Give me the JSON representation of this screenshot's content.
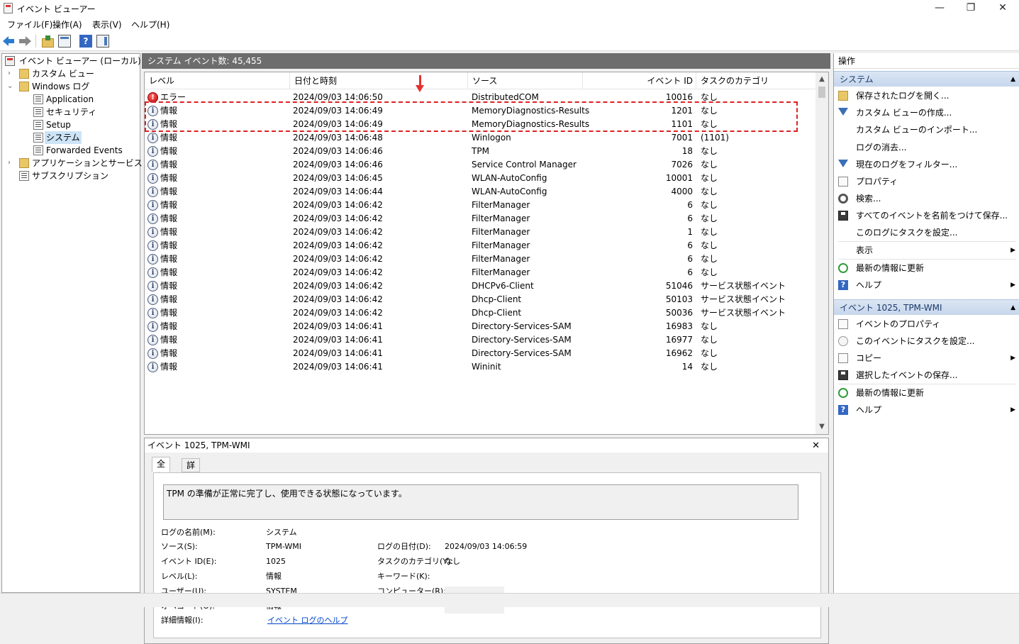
{
  "window": {
    "title": "イベント ビューアー",
    "minimize": "—",
    "maximize": "❐",
    "close": "✕"
  },
  "menu": [
    "ファイル(F)",
    "操作(A)",
    "表示(V)",
    "ヘルプ(H)"
  ],
  "toolbar": {
    "help_glyph": "?"
  },
  "tree": {
    "root": "イベント ビューアー (ローカル)",
    "custom_view": "カスタム ビュー",
    "windows_logs": "Windows ログ",
    "application": "Application",
    "security": "セキュリティ",
    "setup": "Setup",
    "system": "システム",
    "forwarded": "Forwarded Events",
    "apps_services": "アプリケーションとサービス ログ",
    "subscriptions": "サブスクリプション",
    "expand_glyph": "›",
    "collapse_glyph": "⌄"
  },
  "center": {
    "header": "システム    イベント数: 45,455",
    "columns": [
      "レベル",
      "日付と時刻",
      "ソース",
      "イベント ID",
      "タスクのカテゴリ"
    ],
    "rows": [
      {
        "level": "エラー",
        "type": "error",
        "datetime": "2024/09/03 14:06:50",
        "source": "DistributedCOM",
        "id": "10016",
        "category": "なし"
      },
      {
        "level": "情報",
        "type": "info",
        "datetime": "2024/09/03 14:06:49",
        "source": "MemoryDiagnostics-Results",
        "id": "1201",
        "category": "なし"
      },
      {
        "level": "情報",
        "type": "info",
        "datetime": "2024/09/03 14:06:49",
        "source": "MemoryDiagnostics-Results",
        "id": "1101",
        "category": "なし"
      },
      {
        "level": "情報",
        "type": "info",
        "datetime": "2024/09/03 14:06:48",
        "source": "Winlogon",
        "id": "7001",
        "category": "(1101)"
      },
      {
        "level": "情報",
        "type": "info",
        "datetime": "2024/09/03 14:06:46",
        "source": "TPM",
        "id": "18",
        "category": "なし"
      },
      {
        "level": "情報",
        "type": "info",
        "datetime": "2024/09/03 14:06:46",
        "source": "Service Control Manager",
        "id": "7026",
        "category": "なし"
      },
      {
        "level": "情報",
        "type": "info",
        "datetime": "2024/09/03 14:06:45",
        "source": "WLAN-AutoConfig",
        "id": "10001",
        "category": "なし"
      },
      {
        "level": "情報",
        "type": "info",
        "datetime": "2024/09/03 14:06:44",
        "source": "WLAN-AutoConfig",
        "id": "4000",
        "category": "なし"
      },
      {
        "level": "情報",
        "type": "info",
        "datetime": "2024/09/03 14:06:42",
        "source": "FilterManager",
        "id": "6",
        "category": "なし"
      },
      {
        "level": "情報",
        "type": "info",
        "datetime": "2024/09/03 14:06:42",
        "source": "FilterManager",
        "id": "6",
        "category": "なし"
      },
      {
        "level": "情報",
        "type": "info",
        "datetime": "2024/09/03 14:06:42",
        "source": "FilterManager",
        "id": "1",
        "category": "なし"
      },
      {
        "level": "情報",
        "type": "info",
        "datetime": "2024/09/03 14:06:42",
        "source": "FilterManager",
        "id": "6",
        "category": "なし"
      },
      {
        "level": "情報",
        "type": "info",
        "datetime": "2024/09/03 14:06:42",
        "source": "FilterManager",
        "id": "6",
        "category": "なし"
      },
      {
        "level": "情報",
        "type": "info",
        "datetime": "2024/09/03 14:06:42",
        "source": "FilterManager",
        "id": "6",
        "category": "なし"
      },
      {
        "level": "情報",
        "type": "info",
        "datetime": "2024/09/03 14:06:42",
        "source": "DHCPv6-Client",
        "id": "51046",
        "category": "サービス状態イベント"
      },
      {
        "level": "情報",
        "type": "info",
        "datetime": "2024/09/03 14:06:42",
        "source": "Dhcp-Client",
        "id": "50103",
        "category": "サービス状態イベント"
      },
      {
        "level": "情報",
        "type": "info",
        "datetime": "2024/09/03 14:06:42",
        "source": "Dhcp-Client",
        "id": "50036",
        "category": "サービス状態イベント"
      },
      {
        "level": "情報",
        "type": "info",
        "datetime": "2024/09/03 14:06:41",
        "source": "Directory-Services-SAM",
        "id": "16983",
        "category": "なし"
      },
      {
        "level": "情報",
        "type": "info",
        "datetime": "2024/09/03 14:06:41",
        "source": "Directory-Services-SAM",
        "id": "16977",
        "category": "なし"
      },
      {
        "level": "情報",
        "type": "info",
        "datetime": "2024/09/03 14:06:41",
        "source": "Directory-Services-SAM",
        "id": "16962",
        "category": "なし"
      },
      {
        "level": "情報",
        "type": "info",
        "datetime": "2024/09/03 14:06:41",
        "source": "Wininit",
        "id": "14",
        "category": "なし"
      }
    ],
    "scroll": {
      "up": "▲",
      "down": "▼"
    }
  },
  "detail": {
    "header": "イベント 1025, TPM-WMI",
    "close": "✕",
    "tabs": [
      "全般",
      "詳細"
    ],
    "message": "TPM の準備が正常に完了し、使用できる状態になっています。",
    "log_name_label": "ログの名前(M):",
    "log_name": "システム",
    "source_label": "ソース(S):",
    "source": "TPM-WMI",
    "logged_label": "ログの日付(D):",
    "logged": "2024/09/03 14:06:59",
    "event_id_label": "イベント ID(E):",
    "event_id": "1025",
    "task_label": "タスクのカテゴリ(Y):",
    "task": "なし",
    "level_label": "レベル(L):",
    "level": "情報",
    "keywords_label": "キーワード(K):",
    "user_label": "ユーザー(U):",
    "user": "SYSTEM",
    "computer_label": "コンピューター(R):",
    "opcode_label": "オペコード(O):",
    "opcode": "情報",
    "more_label": "詳細情報(I):",
    "more_link": "イベント ログのヘルプ"
  },
  "actions": {
    "title": "操作",
    "section1": "システム",
    "section1_items": [
      "保存されたログを開く...",
      "カスタム ビューの作成...",
      "カスタム ビューのインポート...",
      "ログの消去...",
      "現在のログをフィルター...",
      "プロパティ",
      "検索...",
      "すべてのイベントを名前をつけて保存...",
      "このログにタスクを設定...",
      "表示",
      "最新の情報に更新",
      "ヘルプ"
    ],
    "section2": "イベント 1025, TPM-WMI",
    "section2_items": [
      "イベントのプロパティ",
      "このイベントにタスクを設定...",
      "コピー",
      "選択したイベントの保存...",
      "最新の情報に更新",
      "ヘルプ"
    ],
    "submenu_glyph": "▶",
    "collapse_glyph": "▲",
    "help_glyph": "?"
  }
}
